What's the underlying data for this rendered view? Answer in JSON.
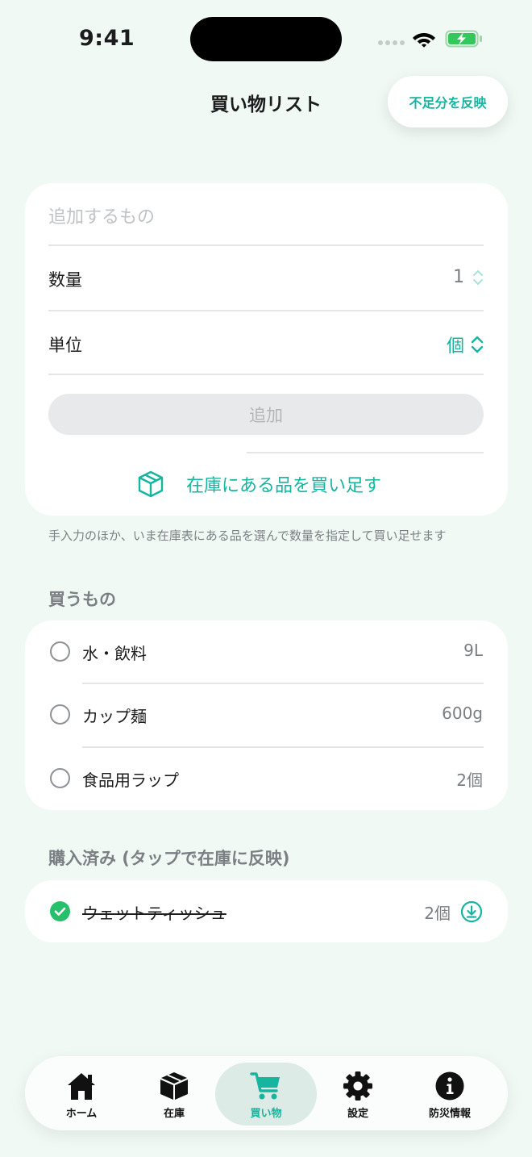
{
  "status_bar": {
    "time": "9:41"
  },
  "header": {
    "title": "買い物リスト",
    "reflect_button": "不足分を反映"
  },
  "add_form": {
    "name_placeholder": "追加するもの",
    "quantity_label": "数量",
    "quantity_value": "1",
    "unit_label": "単位",
    "unit_value": "個",
    "add_button": "追加",
    "restock_link": "在庫にある品を買い足す"
  },
  "note": "手入力のほか、いま在庫表にある品を選んで数量を指定して買い足せます",
  "to_buy": {
    "title": "買うもの",
    "items": [
      {
        "name": "水・飲料",
        "qty": "9L"
      },
      {
        "name": "カップ麺",
        "qty": "600g"
      },
      {
        "name": "食品用ラップ",
        "qty": "2個"
      }
    ]
  },
  "purchased": {
    "title": "購入済み (タップで在庫に反映)",
    "items": [
      {
        "name": "ウェットティッシュ",
        "qty": "2個"
      }
    ]
  },
  "tabs": [
    {
      "label": "ホーム",
      "icon": "house-icon"
    },
    {
      "label": "在庫",
      "icon": "box-icon"
    },
    {
      "label": "買い物",
      "icon": "cart-icon",
      "active": true
    },
    {
      "label": "設定",
      "icon": "gear-icon"
    },
    {
      "label": "防災情報",
      "icon": "info-icon"
    }
  ],
  "colors": {
    "accent": "#16b59f",
    "check": "#26c06c",
    "background": "#f1f9f5"
  }
}
